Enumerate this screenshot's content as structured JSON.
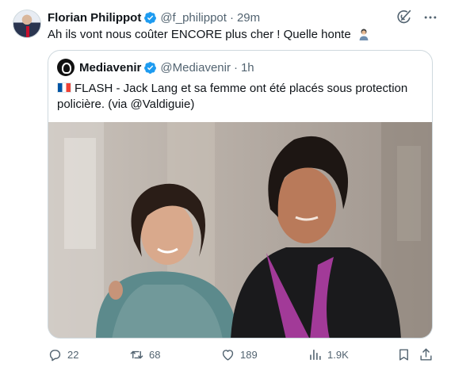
{
  "tweet": {
    "author_name": "Florian Philippot",
    "handle": "@f_philippot",
    "separator": "·",
    "time": "29m",
    "text": "Ah ils vont nous coûter ENCORE plus cher ! Quelle honte",
    "verified_color": "#1d9bf0"
  },
  "quote": {
    "author_name": "Mediavenir",
    "handle": "@Mediavenir",
    "separator": "·",
    "time": "1h",
    "text": "FLASH - Jack Lang et sa femme ont été placés sous protection policière. (via @Valdiguie)",
    "flag_icon": "france-flag-icon"
  },
  "actions": {
    "replies": "22",
    "reposts": "68",
    "likes": "189",
    "views": "1.9K"
  },
  "colors": {
    "muted": "#536471",
    "border": "#cfd9de",
    "text": "#0f1419"
  }
}
